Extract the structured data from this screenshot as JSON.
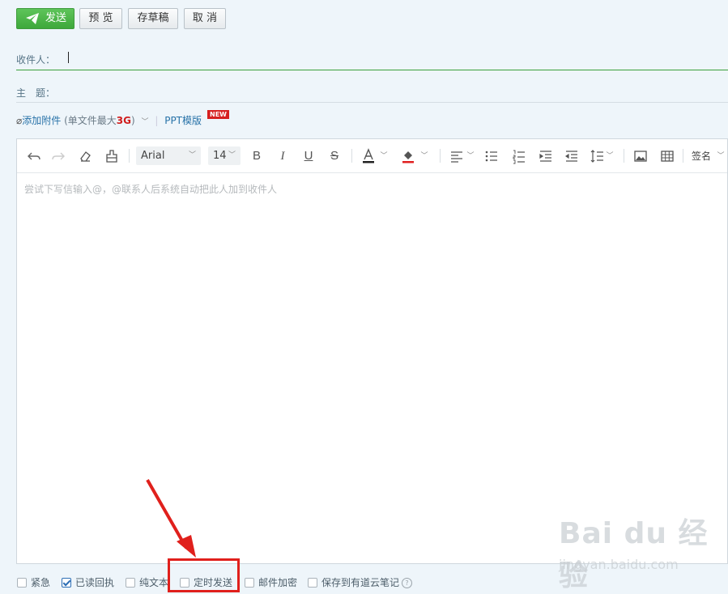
{
  "toolbar_top": {
    "send_label": "发送",
    "preview_label": "预 览",
    "draft_label": "存草稿",
    "cancel_label": "取 消"
  },
  "fields": {
    "to_label": "收件人：",
    "subject_label": "主　题："
  },
  "attach": {
    "add_label": "添加附件",
    "limit_prefix": "(单文件最大",
    "limit_value": "3G",
    "limit_suffix": ")",
    "ppt_label": "PPT模版",
    "new_badge": "NEW"
  },
  "editor": {
    "font_family": "Arial",
    "font_size": "14",
    "signature_label": "签名",
    "placeholder": "尝试下写信输入@，@联系人后系统自动把此人加到收件人"
  },
  "options": [
    {
      "label": "紧急",
      "checked": false
    },
    {
      "label": "已读回执",
      "checked": true
    },
    {
      "label": "纯文本",
      "checked": false
    },
    {
      "label": "定时发送",
      "checked": false
    },
    {
      "label": "邮件加密",
      "checked": false
    },
    {
      "label": "保存到有道云笔记",
      "checked": false
    }
  ],
  "colors": {
    "send_green": "#4cb849",
    "highlight_red": "#e0201c",
    "link_blue": "#2772a8"
  },
  "watermark": {
    "main": "Bai du 经验",
    "sub": "jingyan.baidu.com"
  }
}
